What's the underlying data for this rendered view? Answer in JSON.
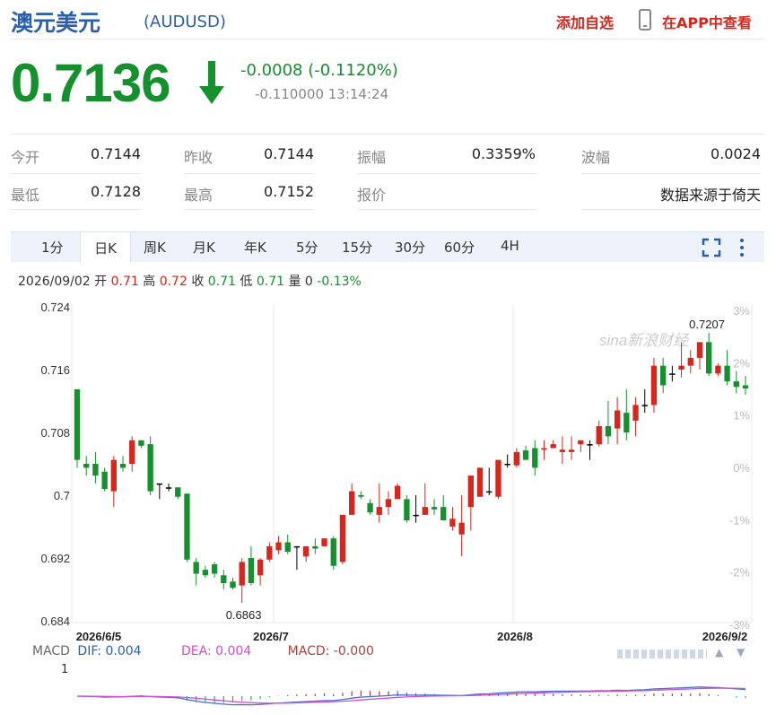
{
  "header": {
    "name": "澳元美元",
    "code": "(AUDUSD)",
    "add_watch": "添加自选",
    "app_view": "在APP中查看",
    "phone_icon": "phone-icon"
  },
  "quote": {
    "price": "0.7136",
    "arrow_icon": "arrow-down-icon",
    "change": "-0.0008 (-0.1120%)",
    "sub": "-0.110000 13:14:24"
  },
  "stats": {
    "open_label": "今开",
    "open": "0.7144",
    "prev_label": "昨收",
    "prev": "0.7144",
    "amp_label": "振幅",
    "amp": "0.3359%",
    "wave_label": "波幅",
    "wave": "0.0024",
    "low_label": "最低",
    "low": "0.7128",
    "high_label": "最高",
    "high": "0.7152",
    "quote_label": "报价",
    "source": "数据来源于倚天"
  },
  "tabs": [
    "1分",
    "日K",
    "周K",
    "月K",
    "年K",
    "5分",
    "15分",
    "30分",
    "60分",
    "4H"
  ],
  "active_tab": "日K",
  "info": {
    "date": "2026/09/02",
    "open_label": "开",
    "open": "0.71",
    "high_label": "高",
    "high": "0.72",
    "close_label": "收",
    "close": "0.71",
    "low_label": "低",
    "low": "0.71",
    "vol_label": "量",
    "vol": "0",
    "pct": "-0.13%"
  },
  "colors": {
    "up": "#d7261c",
    "down": "#14902c",
    "accent": "#2a5fae"
  },
  "chart_data": {
    "type": "candlestick",
    "y_ticks": [
      "0.724",
      "0.716",
      "0.708",
      "0.7",
      "0.692",
      "0.684"
    ],
    "pct_ticks": [
      "3%",
      "2%",
      "1%",
      "0%",
      "-1%",
      "-2%",
      "-3%"
    ],
    "x_ticks": [
      "2026/6/5",
      "2026/7",
      "2026/8",
      "2026/9/2"
    ],
    "ylim": [
      0.684,
      0.724
    ],
    "max_label": "0.7207",
    "min_label": "0.6863",
    "watermark": "sina新浪财经",
    "candles": [
      [
        0.7135,
        0.7135,
        0.7035,
        0.7045
      ],
      [
        0.704,
        0.705,
        0.7025,
        0.7035
      ],
      [
        0.704,
        0.7055,
        0.7015,
        0.7025
      ],
      [
        0.703,
        0.7035,
        0.7005,
        0.7008
      ],
      [
        0.7005,
        0.705,
        0.6985,
        0.7045
      ],
      [
        0.704,
        0.705,
        0.703,
        0.7035
      ],
      [
        0.704,
        0.7075,
        0.703,
        0.707
      ],
      [
        0.707,
        0.707,
        0.706,
        0.7063
      ],
      [
        0.7065,
        0.7075,
        0.7,
        0.7005
      ],
      [
        0.7015,
        0.7015,
        0.6995,
        0.7015
      ],
      [
        0.701,
        0.7015,
        0.7005,
        0.701
      ],
      [
        0.701,
        0.701,
        0.6995,
        0.6998
      ],
      [
        0.7002,
        0.7002,
        0.6915,
        0.6918
      ],
      [
        0.6915,
        0.692,
        0.6885,
        0.69
      ],
      [
        0.6905,
        0.691,
        0.6895,
        0.6898
      ],
      [
        0.6912,
        0.6915,
        0.6895,
        0.69
      ],
      [
        0.6898,
        0.6905,
        0.688,
        0.6888
      ],
      [
        0.689,
        0.6895,
        0.688,
        0.6882
      ],
      [
        0.6885,
        0.692,
        0.6863,
        0.6915
      ],
      [
        0.692,
        0.6935,
        0.6885,
        0.6888
      ],
      [
        0.6898,
        0.692,
        0.6885,
        0.6918
      ],
      [
        0.6918,
        0.694,
        0.6915,
        0.6935
      ],
      [
        0.693,
        0.6948,
        0.6925,
        0.694
      ],
      [
        0.694,
        0.695,
        0.6925,
        0.6928
      ],
      [
        0.6935,
        0.6935,
        0.6905,
        0.6935
      ],
      [
        0.6922,
        0.6935,
        0.6915,
        0.6935
      ],
      [
        0.6935,
        0.6945,
        0.6925,
        0.6932
      ],
      [
        0.6935,
        0.6945,
        0.6935,
        0.6945
      ],
      [
        0.6945,
        0.6948,
        0.6905,
        0.691
      ],
      [
        0.6915,
        0.6975,
        0.6912,
        0.6975
      ],
      [
        0.6975,
        0.7015,
        0.6975,
        0.7005
      ],
      [
        0.7,
        0.7005,
        0.6995,
        0.6998
      ],
      [
        0.699,
        0.6995,
        0.6975,
        0.6978
      ],
      [
        0.6975,
        0.7015,
        0.6965,
        0.6985
      ],
      [
        0.6985,
        0.7005,
        0.6975,
        0.6995
      ],
      [
        0.6995,
        0.7015,
        0.6995,
        0.7012
      ],
      [
        0.6995,
        0.7,
        0.6965,
        0.6968
      ],
      [
        0.6975,
        0.7,
        0.6965,
        0.6975
      ],
      [
        0.6975,
        0.7015,
        0.6975,
        0.6985
      ],
      [
        0.6985,
        0.6995,
        0.6975,
        0.6982
      ],
      [
        0.6985,
        0.7,
        0.6975,
        0.6968
      ],
      [
        0.696,
        0.6985,
        0.6955,
        0.697
      ],
      [
        0.695,
        0.7,
        0.6922,
        0.6965
      ],
      [
        0.6985,
        0.7025,
        0.6955,
        0.7025
      ],
      [
        0.6998,
        0.7035,
        0.6998,
        0.7035
      ],
      [
        0.7005,
        0.7035,
        0.7,
        0.7005
      ],
      [
        0.6998,
        0.7045,
        0.6995,
        0.7045
      ],
      [
        0.704,
        0.7052,
        0.7035,
        0.704
      ],
      [
        0.7038,
        0.706,
        0.7035,
        0.7055
      ],
      [
        0.7057,
        0.7063,
        0.7045,
        0.7045
      ],
      [
        0.706,
        0.707,
        0.7025,
        0.7035
      ],
      [
        0.7058,
        0.707,
        0.7045,
        0.706
      ],
      [
        0.706,
        0.707,
        0.706,
        0.7065
      ],
      [
        0.7055,
        0.7075,
        0.704,
        0.7058
      ],
      [
        0.7055,
        0.7075,
        0.7045,
        0.7058
      ],
      [
        0.7065,
        0.707,
        0.7055,
        0.707
      ],
      [
        0.7065,
        0.707,
        0.7045,
        0.7065
      ],
      [
        0.7065,
        0.7095,
        0.7062,
        0.7088
      ],
      [
        0.7088,
        0.712,
        0.7065,
        0.7075
      ],
      [
        0.7085,
        0.7125,
        0.7065,
        0.7108
      ],
      [
        0.7105,
        0.7135,
        0.707,
        0.708
      ],
      [
        0.7095,
        0.7125,
        0.7075,
        0.7115
      ],
      [
        0.7115,
        0.7135,
        0.7105,
        0.7115
      ],
      [
        0.7115,
        0.7175,
        0.7105,
        0.7165
      ],
      [
        0.7165,
        0.7175,
        0.713,
        0.714
      ],
      [
        0.7155,
        0.7165,
        0.7145,
        0.7155
      ],
      [
        0.716,
        0.7195,
        0.715,
        0.7165
      ],
      [
        0.7165,
        0.7185,
        0.7155,
        0.7175
      ],
      [
        0.7175,
        0.7195,
        0.716,
        0.7195
      ],
      [
        0.7195,
        0.7207,
        0.7152,
        0.7155
      ],
      [
        0.7155,
        0.7168,
        0.7152,
        0.7165
      ],
      [
        0.7165,
        0.7185,
        0.714,
        0.7145
      ],
      [
        0.7145,
        0.7158,
        0.713,
        0.7138
      ],
      [
        0.714,
        0.7152,
        0.7128,
        0.7136
      ]
    ]
  },
  "macd": {
    "label": "MACD",
    "dif": "DIF: 0.004",
    "dea": "DEA: 0.004",
    "macd": "MACD: -0.000",
    "axis_top": "1"
  }
}
